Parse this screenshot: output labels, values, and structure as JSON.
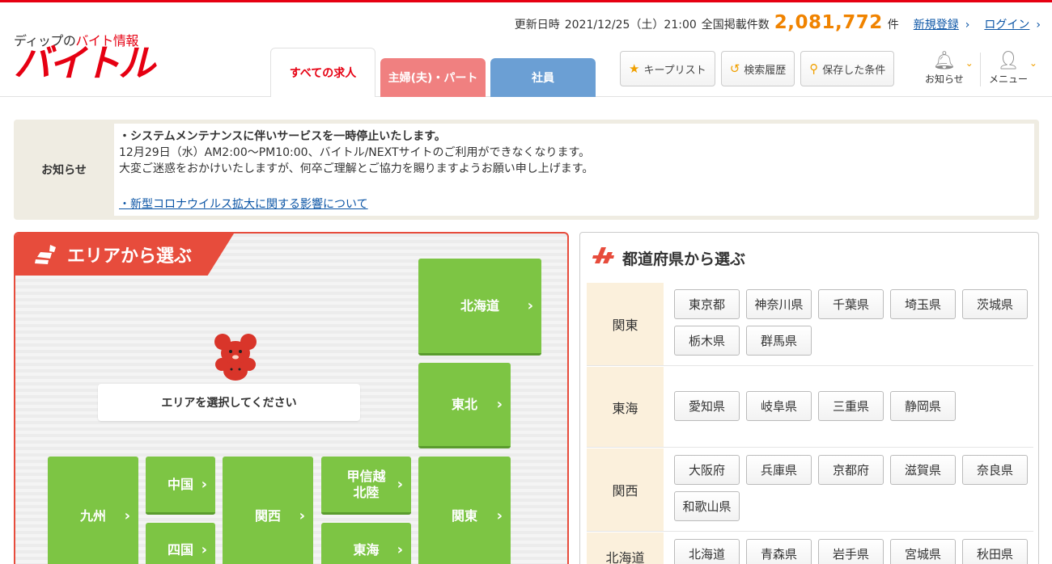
{
  "header": {
    "logo_sub_prefix": "ディップの",
    "logo_sub_red": "バイト情報",
    "logo_main": "バイトル",
    "update_label": "更新日時",
    "update_datetime": "2021/12/25（土）21:00",
    "total_label": "全国掲載件数",
    "total_count": "2,081,772",
    "total_unit": "件",
    "register_link": "新規登録",
    "login_link": "ログイン",
    "tabs": [
      {
        "label": "すべての求人"
      },
      {
        "label": "主婦(夫)・パート"
      },
      {
        "label": "社員"
      }
    ],
    "tools": [
      {
        "label": "キープリスト",
        "icon": "★"
      },
      {
        "label": "検索履歴",
        "icon": "↺"
      },
      {
        "label": "保存した条件",
        "icon": "⚲"
      }
    ],
    "notify_label": "お知らせ",
    "menu_label": "メニュー"
  },
  "notice": {
    "label": "お知らせ",
    "line1": "・システムメンテナンスに伴いサービスを一時停止いたします。",
    "line2": "12月29日（水）AM2:00〜PM10:00、バイトル/NEXTサイトのご利用ができなくなります。",
    "line3": "大変ご迷惑をおかけいたしますが、何卒ご理解とご協力を賜りますようお願い申し上げます。",
    "link": "・新型コロナウイルス拡大に関する影響について"
  },
  "area": {
    "title": "エリアから選ぶ",
    "prompt": "エリアを選択してください",
    "regions": {
      "hokkaido": "北海道",
      "tohoku": "東北",
      "kyushu": "九州",
      "chugoku": "中国",
      "shikoku": "四国",
      "kansai": "関西",
      "koshinetsu_1": "甲信越",
      "koshinetsu_2": "北陸",
      "tokai": "東海",
      "kanto": "関東"
    }
  },
  "prefectures": {
    "title": "都道府県から選ぶ",
    "rows": [
      {
        "region": "関東",
        "items": [
          "東京都",
          "神奈川県",
          "千葉県",
          "埼玉県",
          "茨城県",
          "栃木県",
          "群馬県"
        ]
      },
      {
        "region": "東海",
        "items": [
          "愛知県",
          "岐阜県",
          "三重県",
          "静岡県"
        ]
      },
      {
        "region": "関西",
        "items": [
          "大阪府",
          "兵庫県",
          "京都府",
          "滋賀県",
          "奈良県",
          "和歌山県"
        ]
      },
      {
        "region": "北海道",
        "items": [
          "北海道",
          "青森県",
          "岩手県",
          "宮城県",
          "秋田県"
        ]
      }
    ]
  }
}
